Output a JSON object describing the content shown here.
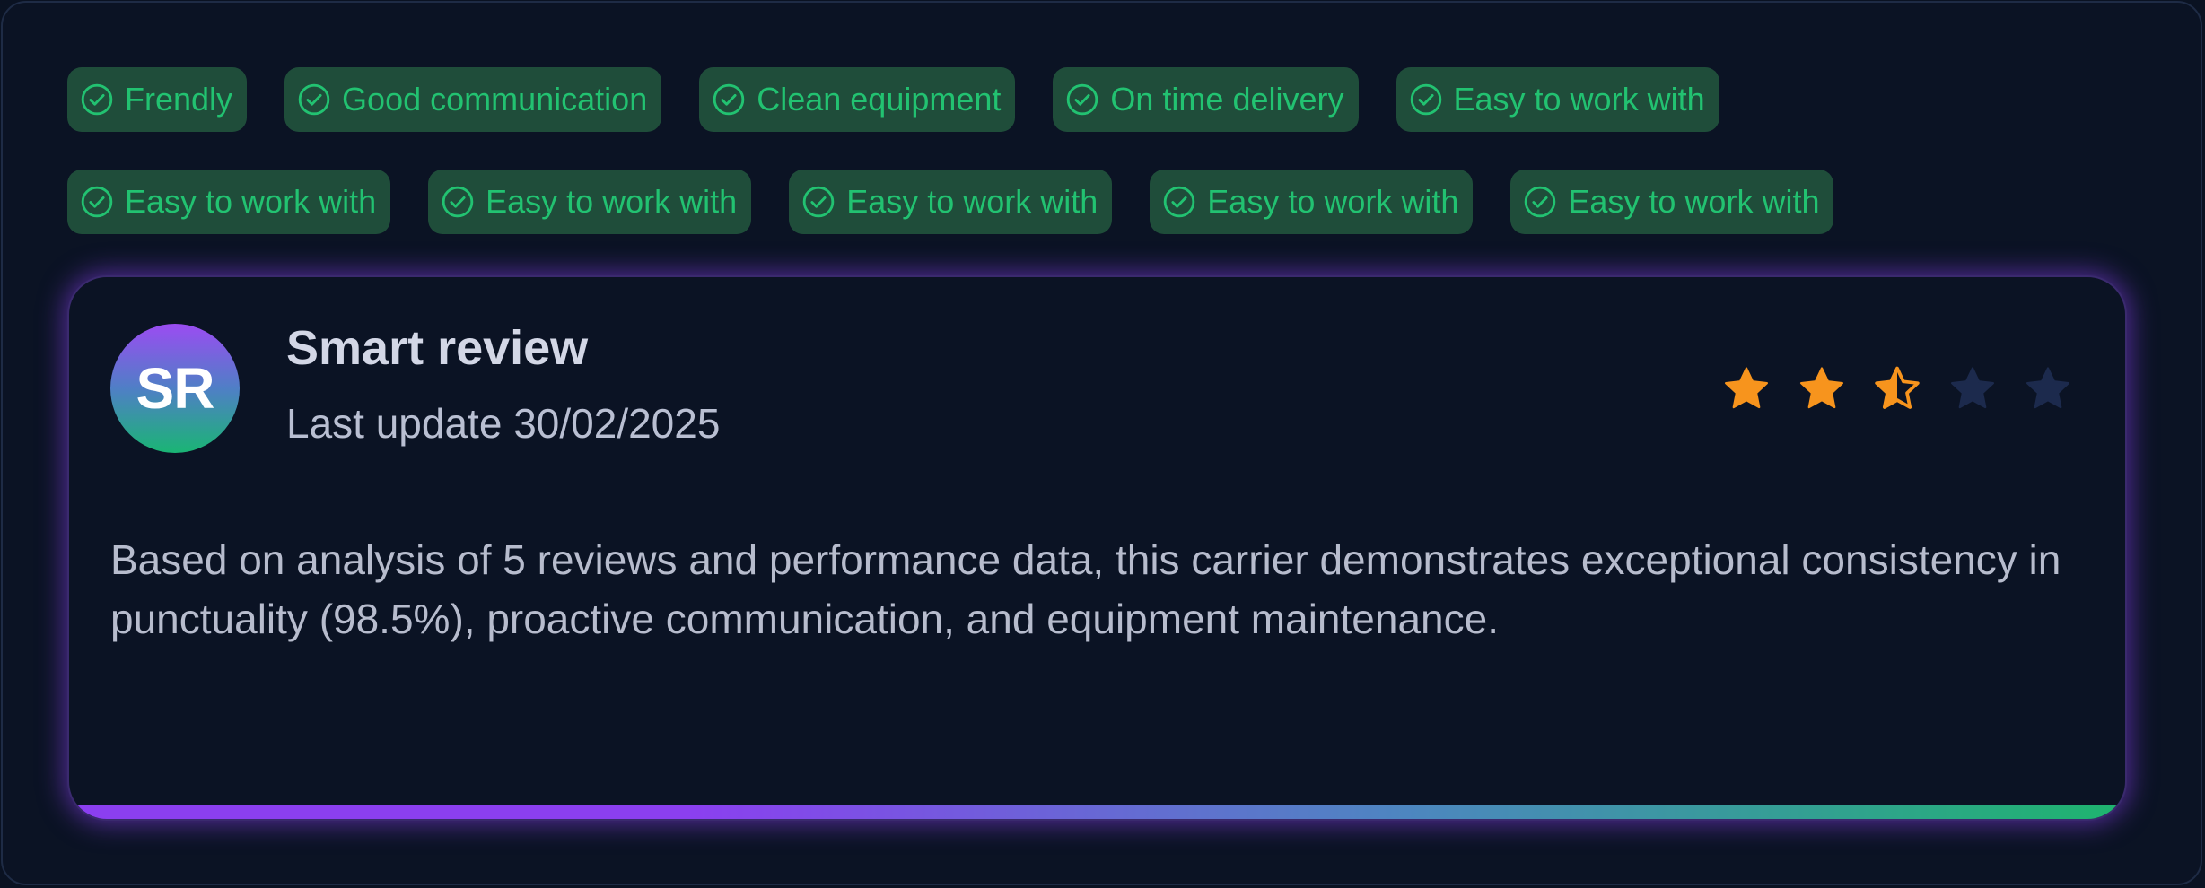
{
  "tags": {
    "row1": [
      "Frendly",
      "Good communication",
      "Clean equipment",
      "On time delivery",
      "Easy to work with"
    ],
    "row2": [
      "Easy to work with",
      "Easy to work with",
      "Easy to work with",
      "Easy to work with",
      "Easy to work with"
    ]
  },
  "review": {
    "avatar_initials": "SR",
    "title": "Smart review",
    "subtitle": "Last update 30/02/2025",
    "rating": {
      "value": 2.5,
      "max": 5
    },
    "body": "Based on analysis of 5 reviews and performance data, this carrier demonstrates exceptional consistency in punctuality (98.5%), proactive communication, and equipment maintenance."
  },
  "colors": {
    "background": "#0b1324",
    "tag_background": "#1f4d3a",
    "tag_text": "#22c271",
    "star_filled": "#f7941d",
    "star_empty": "#1c2a4d",
    "accent_purple": "#8b3ff0",
    "accent_green": "#1eb46e"
  },
  "icons": {
    "tag_icon": "check-circle-icon",
    "rating_icon": "star-icon"
  }
}
